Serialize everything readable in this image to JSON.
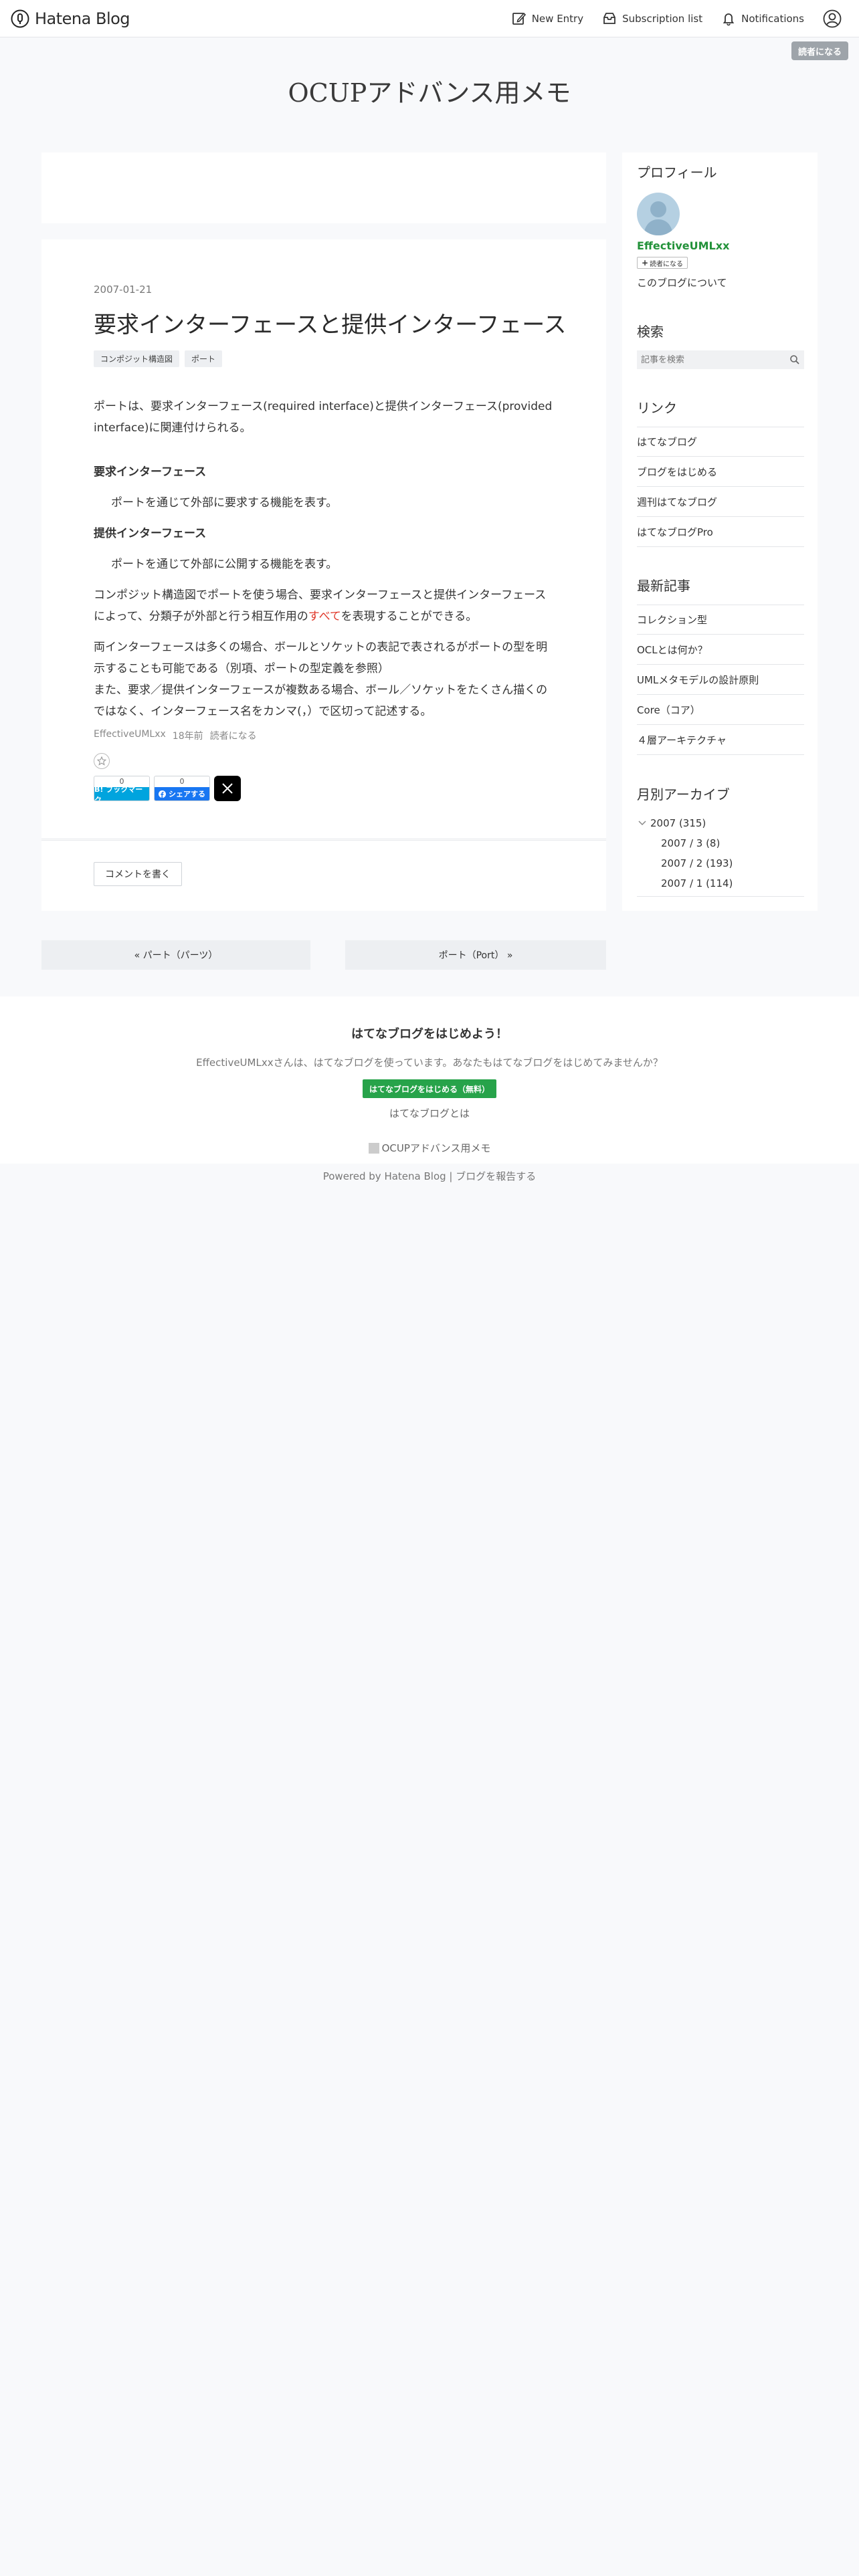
{
  "header": {
    "logo_text": "Hatena Blog",
    "new_entry": "New Entry",
    "subscription_list": "Subscription list",
    "notifications": "Notifications",
    "subscribe_badge": "読者になる"
  },
  "blog": {
    "title": "OCUPアドバンス用メモ"
  },
  "entry": {
    "date": "2007-01-21",
    "title": "要求インターフェースと提供インターフェース",
    "categories": [
      "コンポジット構造図",
      "ポート"
    ],
    "paragraphs": {
      "p1": "ポートは、要求インターフェース(required interface)と提供インターフェース(provided interface)に関連付けられる。",
      "h1": "要求インターフェース",
      "d1": "ポートを通じて外部に要求する機能を表す。",
      "h2": "提供インターフェース",
      "d2": "ポートを通じて外部に公開する機能を表す。",
      "p2a": "コンポジット構造図でポートを使う場合、要求インターフェースと提供インターフェースによって、分類子が外部と行う相互作用の",
      "p2b": "すべて",
      "p2c": "を表現することができる。",
      "p3": "両インターフェースは多くの場合、ボールとソケットの表記で表されるがポートの型を明示することも可能である（別項、ポートの型定義を参照）",
      "p4": "また、要求／提供インターフェースが複数ある場合、ボール／ソケットをたくさん描くのではなく、インターフェース名をカンマ(，）で区切って記述する。"
    },
    "footer_author": "EffectiveUMLxx",
    "footer_time": "18年前",
    "footer_subscribe": "読者になる",
    "share": {
      "hatebu_count": "0",
      "hatebu_label": "B! ブックマーク",
      "fb_count": "0",
      "fb_label": "シェアする"
    },
    "comment_button": "コメントを書く"
  },
  "pager": {
    "prev": "« パート（パーツ）",
    "next": "ポート（Port） »"
  },
  "sidebar": {
    "profile_heading": "プロフィール",
    "username": "EffectiveUMLxx",
    "follow": "読者になる",
    "about": "このブログについて",
    "search_heading": "検索",
    "search_placeholder": "記事を検索",
    "links_heading": "リンク",
    "links": [
      "はてなブログ",
      "ブログをはじめる",
      "週刊はてなブログ",
      "はてなブログPro"
    ],
    "recent_heading": "最新記事",
    "recent": [
      "コレクション型",
      "OCLとは何か？",
      "UMLメタモデルの設計原則",
      "Core（コア）",
      "４層アーキテクチャ"
    ],
    "archive_heading": "月別アーカイブ",
    "archive_year": "2007 (315)",
    "archive_months": [
      "2007 / 3 (8)",
      "2007 / 2 (193)",
      "2007 / 1 (114)"
    ]
  },
  "footer": {
    "title": "はてなブログをはじめよう！",
    "desc": "EffectiveUMLxxさんは、はてなブログを使っています。あなたもはてなブログをはじめてみませんか？",
    "start": "はてなブログをはじめる（無料）",
    "what": "はてなブログとは",
    "blog_name": "OCUPアドバンス用メモ",
    "powered": "Powered by Hatena Blog",
    "separator": " | ",
    "report": "ブログを報告する"
  },
  "colors": {
    "accent_green": "#23923a",
    "start_button": "#27a34a",
    "hatebu": "#00a4de",
    "facebook": "#1877f2",
    "highlight_red": "#e0382a"
  }
}
